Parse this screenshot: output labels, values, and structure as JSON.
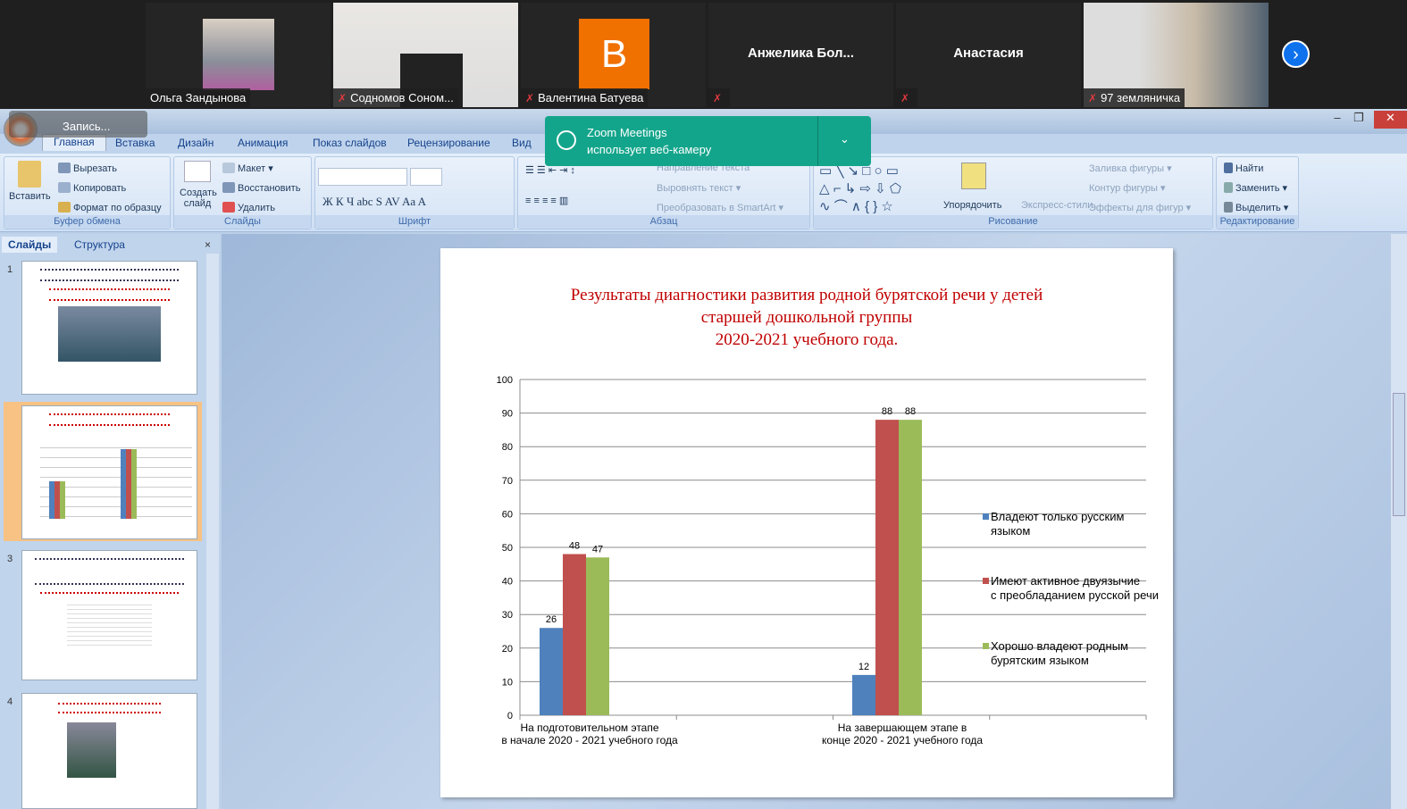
{
  "participants": [
    {
      "name": "Ольга  Зандынова",
      "muted": false
    },
    {
      "name": "Содномов Соном...",
      "muted": true
    },
    {
      "name": "Валентина Батуева",
      "muted": true,
      "avatar_letter": "В",
      "avatar_color": "#f07000"
    },
    {
      "name": "",
      "muted": true,
      "center_name": "Анжелика  Бол..."
    },
    {
      "name": "",
      "muted": true,
      "center_name": "Анастасия"
    },
    {
      "name": "97 земляничка",
      "muted": true
    }
  ],
  "recording_label": "Запись...",
  "toast": {
    "title": "Zoom Meetings",
    "message": "использует веб-камеру"
  },
  "tabs": [
    "Главная",
    "Вставка",
    "Дизайн",
    "Анимация",
    "Показ слайдов",
    "Рецензирование",
    "Вид"
  ],
  "ribbon": {
    "clipboard": {
      "paste": "Вставить",
      "cut": "Вырезать",
      "copy": "Копировать",
      "format": "Формат по образцу",
      "label": "Буфер обмена"
    },
    "slides": {
      "new": "Создать слайд",
      "layout": "Макет",
      "reset": "Восстановить",
      "delete": "Удалить",
      "label": "Слайды"
    },
    "font": {
      "label": "Шрифт"
    },
    "paragraph": {
      "direction": "Направление текста",
      "align": "Выровнять текст",
      "smartart": "Преобразовать в SmartArt",
      "label": "Абзац"
    },
    "drawing": {
      "arrange": "Упорядочить",
      "styles": "Экспресс-стили",
      "fill": "Заливка фигуры",
      "outline": "Контур фигуры",
      "effects": "Эффекты для фигур",
      "label": "Рисование"
    },
    "editing": {
      "find": "Найти",
      "replace": "Заменить",
      "select": "Выделить",
      "label": "Редактирование"
    }
  },
  "panel": {
    "tab_slides": "Слайды",
    "tab_outline": "Структура",
    "slide_numbers": [
      "1",
      "2",
      "3",
      "4"
    ]
  },
  "slide": {
    "title_lines": [
      "Результаты диагностики развития родной бурятской речи у детей",
      "старшей дошкольной группы",
      "2020-2021 учебного года."
    ]
  },
  "chart_data": {
    "type": "bar",
    "categories": [
      "На подготовительном  этапе в начале 2020 - 2021 учебного года",
      "На завершающем  этапе в конце 2020 - 2021 учебного года"
    ],
    "series": [
      {
        "name": "Владеют только русским языком",
        "color": "#4f81bd",
        "values": [
          26,
          12
        ]
      },
      {
        "name": "Имеют активное двуязычие с преобладанием русской речи",
        "color": "#c0504d",
        "values": [
          48,
          88
        ]
      },
      {
        "name": "Хорошо владеют родным бурятским языком",
        "color": "#9bbb59",
        "values": [
          47,
          88
        ]
      }
    ],
    "ylim": [
      0,
      100
    ],
    "yticks": [
      0,
      10,
      20,
      30,
      40,
      50,
      60,
      70,
      80,
      90,
      100
    ],
    "grid": true,
    "legend": "right"
  }
}
